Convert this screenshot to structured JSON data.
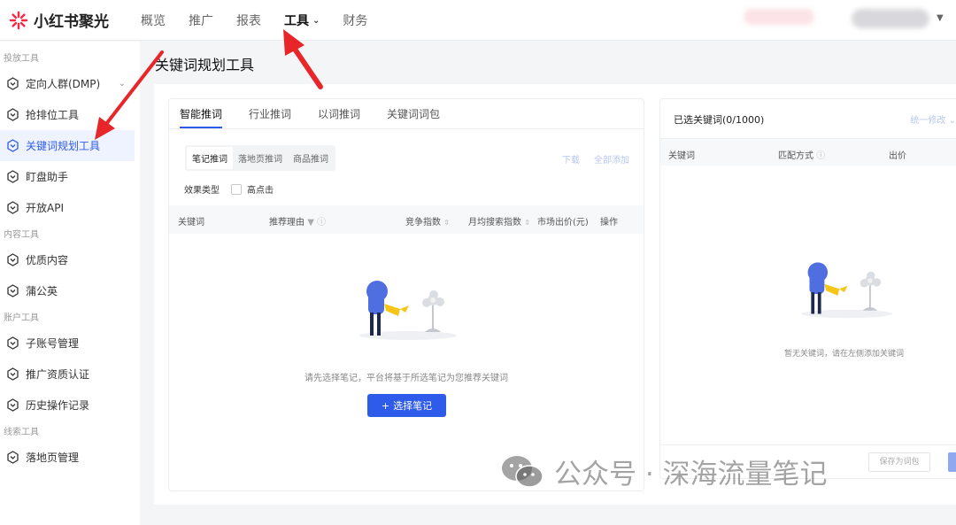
{
  "brand": {
    "name": "小红书聚光",
    "accent": "#2f5bea",
    "logo_color": "#ff2442"
  },
  "nav": [
    {
      "label": "概览",
      "active": false
    },
    {
      "label": "推广",
      "active": false
    },
    {
      "label": "报表",
      "active": false
    },
    {
      "label": "工具",
      "active": true
    },
    {
      "label": "财务",
      "active": false
    }
  ],
  "sidebar": {
    "groups": [
      {
        "title": "投放工具",
        "items": [
          {
            "label": "定向人群(DMP)",
            "has_chevron": true,
            "active": false
          },
          {
            "label": "抢排位工具",
            "active": false
          },
          {
            "label": "关键词规划工具",
            "active": true
          },
          {
            "label": "盯盘助手",
            "active": false
          },
          {
            "label": "开放API",
            "active": false
          }
        ]
      },
      {
        "title": "内容工具",
        "items": [
          {
            "label": "优质内容",
            "active": false
          },
          {
            "label": "蒲公英",
            "active": false
          }
        ]
      },
      {
        "title": "账户工具",
        "items": [
          {
            "label": "子账号管理",
            "active": false
          },
          {
            "label": "推广资质认证",
            "active": false
          },
          {
            "label": "历史操作记录",
            "active": false
          }
        ]
      },
      {
        "title": "线索工具",
        "items": [
          {
            "label": "落地页管理",
            "active": false
          }
        ]
      }
    ]
  },
  "page": {
    "title": "关键词规划工具"
  },
  "left": {
    "tabs": [
      "智能推词",
      "行业推词",
      "以词推词",
      "关键词词包"
    ],
    "active_tab": 0,
    "subtabs": [
      "笔记推词",
      "落地页推词",
      "商品推词"
    ],
    "active_subtab": 0,
    "links": {
      "download": "下载",
      "add_all": "全部添加"
    },
    "filter": {
      "label": "效果类型",
      "option": "高点击",
      "checked": false
    },
    "columns": {
      "keyword": "关键词",
      "reason": "推荐理由",
      "competition": "竞争指数",
      "monthly_search": "月均搜索指数",
      "market_bid": "市场出价(元)",
      "action": "操作"
    },
    "empty_text": "请先选择笔记，平台将基于所选笔记为您推荐关键词",
    "select_button": "选择笔记"
  },
  "right": {
    "title": "已选关键词(0/1000)",
    "batch_edit": "统一修改",
    "columns": {
      "keyword": "关键词",
      "match": "匹配方式",
      "bid": "出价"
    },
    "empty_text": "暂无关键词，请在左侧添加关键词",
    "save_pack": "保存为词包"
  },
  "watermark": "公众号 · 深海流量笔记",
  "annotation_color": "#e8262a"
}
